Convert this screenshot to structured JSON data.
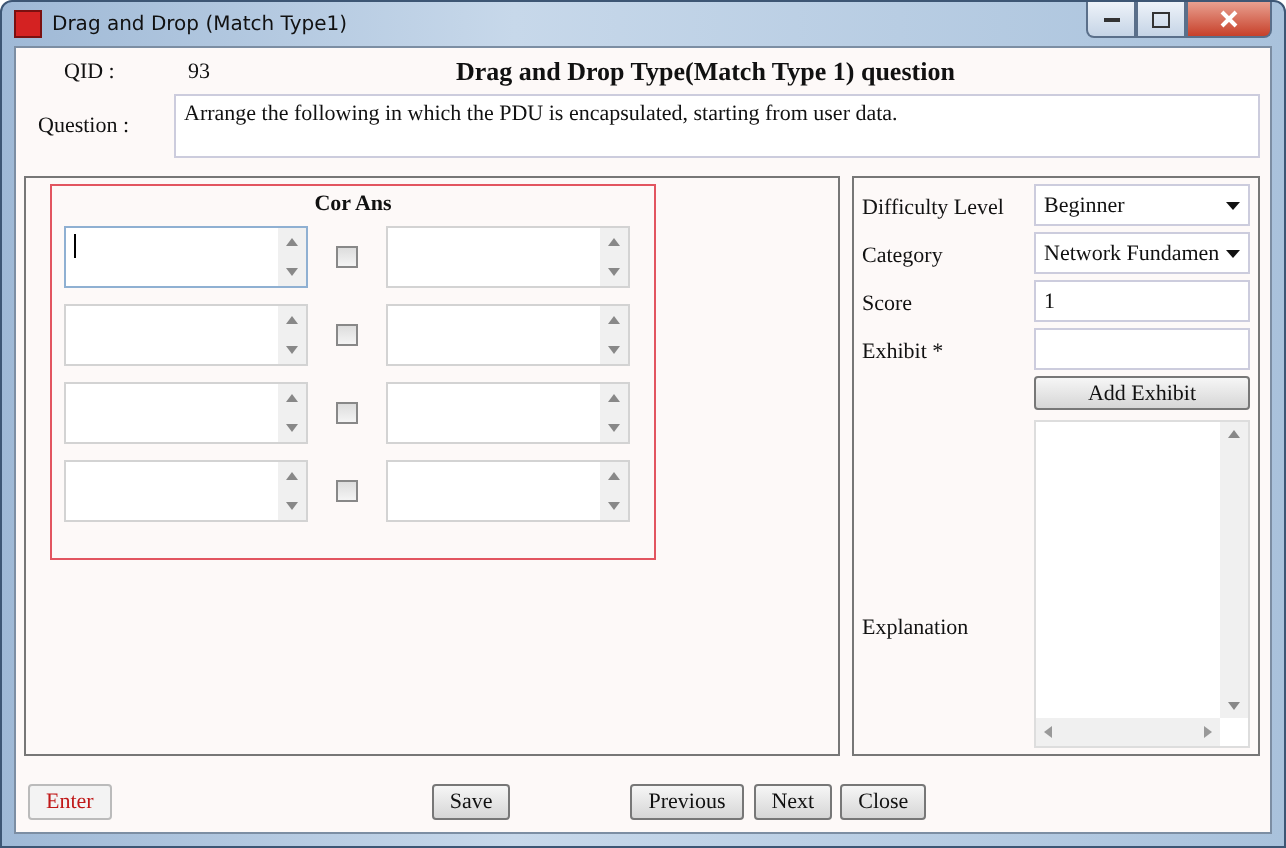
{
  "window": {
    "title": "Drag and Drop (Match Type1)"
  },
  "header": {
    "qid_label": "QID :",
    "qid": "93",
    "heading": "Drag and Drop Type(Match Type 1) question"
  },
  "question": {
    "label": "Question :",
    "value": "Arrange the following in which the PDU is encapsulated, starting from user data."
  },
  "match": {
    "title": "Cor Ans",
    "rows": [
      {
        "focused": true,
        "checked": false
      },
      {
        "focused": false,
        "checked": false
      },
      {
        "focused": false,
        "checked": false
      },
      {
        "focused": false,
        "checked": false
      }
    ]
  },
  "properties": [
    {
      "kind": "select",
      "label": "Difficulty Level",
      "value": "Beginner"
    },
    {
      "kind": "select",
      "label": "Category",
      "value": "Network Fundamen"
    },
    {
      "kind": "input",
      "label": "Score",
      "value": "1"
    },
    {
      "kind": "input",
      "label": "Exhibit *"
    }
  ],
  "add_exhibit": "Add Exhibit",
  "explanation": {
    "label": "Explanation"
  },
  "buttons": [
    {
      "label": "Enter",
      "kind": "accent"
    },
    {
      "label": "Save",
      "kind": "normal"
    },
    {
      "label": "Previous",
      "kind": "normal"
    },
    {
      "label": "Next",
      "kind": "normal"
    },
    {
      "label": "Close",
      "kind": "normal"
    }
  ]
}
